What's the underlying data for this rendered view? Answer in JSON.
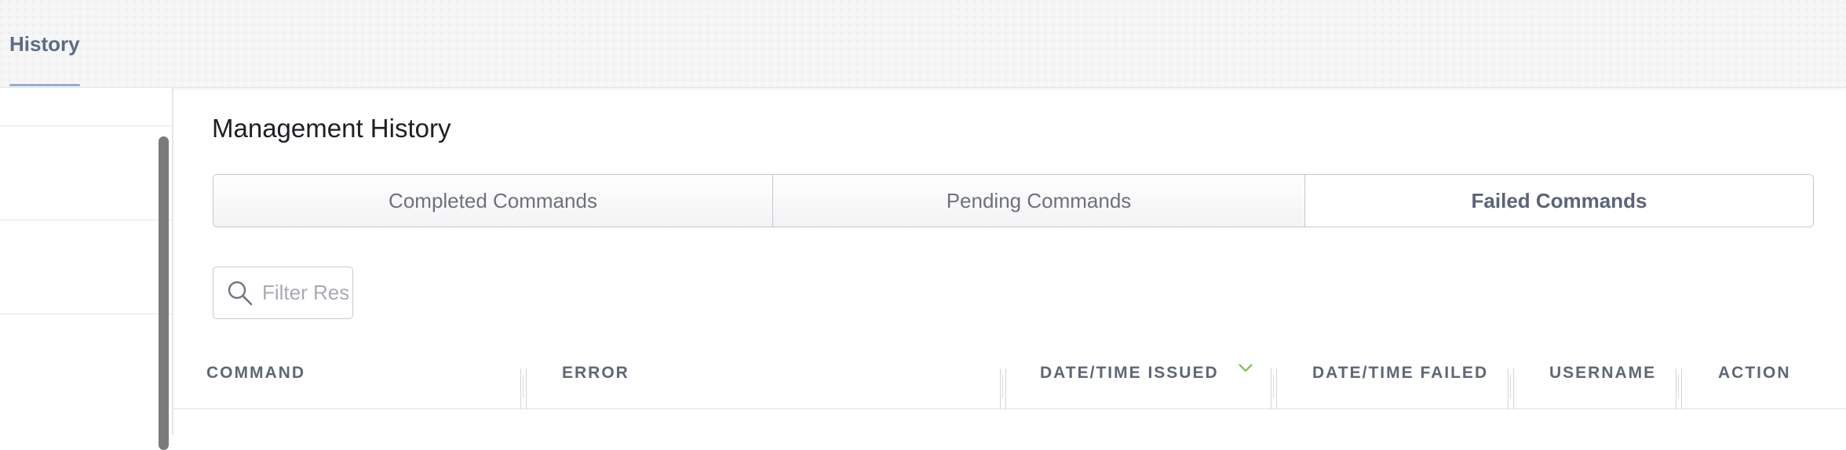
{
  "top_tabs": [
    {
      "label": "History",
      "active": true
    }
  ],
  "page_title": "Management History",
  "segments": [
    {
      "label": "Completed Commands",
      "active": false
    },
    {
      "label": "Pending Commands",
      "active": false
    },
    {
      "label": "Failed Commands",
      "active": true
    }
  ],
  "filter": {
    "placeholder": "Filter Results",
    "value": "",
    "icon": "search-icon"
  },
  "table": {
    "columns": [
      {
        "label": "COMMAND"
      },
      {
        "label": "ERROR"
      },
      {
        "label": "DATE/TIME ISSUED",
        "sorted": "desc"
      },
      {
        "label": "DATE/TIME FAILED"
      },
      {
        "label": "USERNAME"
      },
      {
        "label": "ACTION"
      }
    ]
  },
  "colors": {
    "accent_tab": "#5d6b86",
    "tab_underline": "#97add2",
    "sort_indicator": "#7cc04b",
    "header_text": "#5e6677"
  }
}
